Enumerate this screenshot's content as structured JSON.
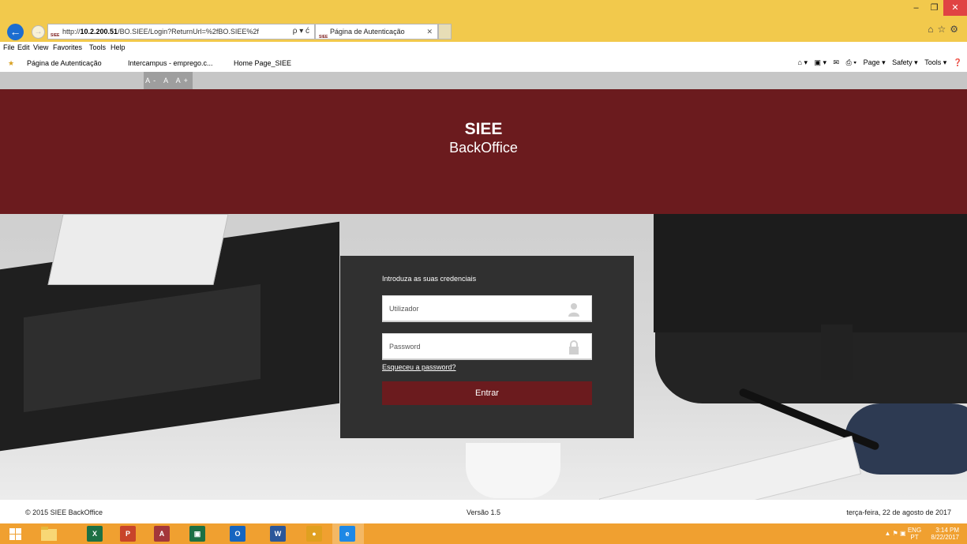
{
  "browser": {
    "address_prefix": "http://",
    "address_host": "10.2.200.51",
    "address_path": "/BO.SIEE/Login?ReturnUrl=%2fBO.SIEE%2f",
    "address_tools": "ρ ▾ ć",
    "tab_title": "Página de Autenticação",
    "favicon_text": "SIEE",
    "menu": [
      "File",
      "Edit",
      "View",
      "Favorites",
      "Tools",
      "Help"
    ],
    "favorites": [
      "Página de Autenticação",
      "Intercampus - emprego.c...",
      "Home Page_SIEE"
    ],
    "command_bar": [
      "Page ▾",
      "Safety ▾",
      "Tools ▾"
    ]
  },
  "accessibility": {
    "font_tools": "A- A A+"
  },
  "header": {
    "title": "SIEE",
    "subtitle": "BackOffice"
  },
  "login": {
    "prompt": "Introduza as suas credenciais",
    "username_placeholder": "Utilizador",
    "password_placeholder": "Password",
    "forgot_link": "Esqueceu a password?",
    "submit_label": "Entrar"
  },
  "footer": {
    "copyright": "© 2015 SIEE BackOffice",
    "version": "Versão 1.5",
    "date": "terça-feira, 22 de agosto de 2017"
  },
  "taskbar": {
    "apps": [
      {
        "name": "excel",
        "label": "X",
        "color": "#1d7044"
      },
      {
        "name": "powerpoint",
        "label": "P",
        "color": "#c8442a"
      },
      {
        "name": "access",
        "label": "A",
        "color": "#a4373a"
      },
      {
        "name": "store",
        "label": "▣",
        "color": "#1d7044"
      },
      {
        "name": "outlook",
        "label": "O",
        "color": "#1565c0"
      },
      {
        "name": "word",
        "label": "W",
        "color": "#2b579a"
      },
      {
        "name": "chrome",
        "label": "●",
        "color": "#e0a020"
      },
      {
        "name": "internet-explorer",
        "label": "e",
        "color": "#1e88e5"
      }
    ],
    "lang_primary": "ENG",
    "lang_secondary": "PT",
    "time": "3:14 PM",
    "date": "8/22/2017"
  }
}
